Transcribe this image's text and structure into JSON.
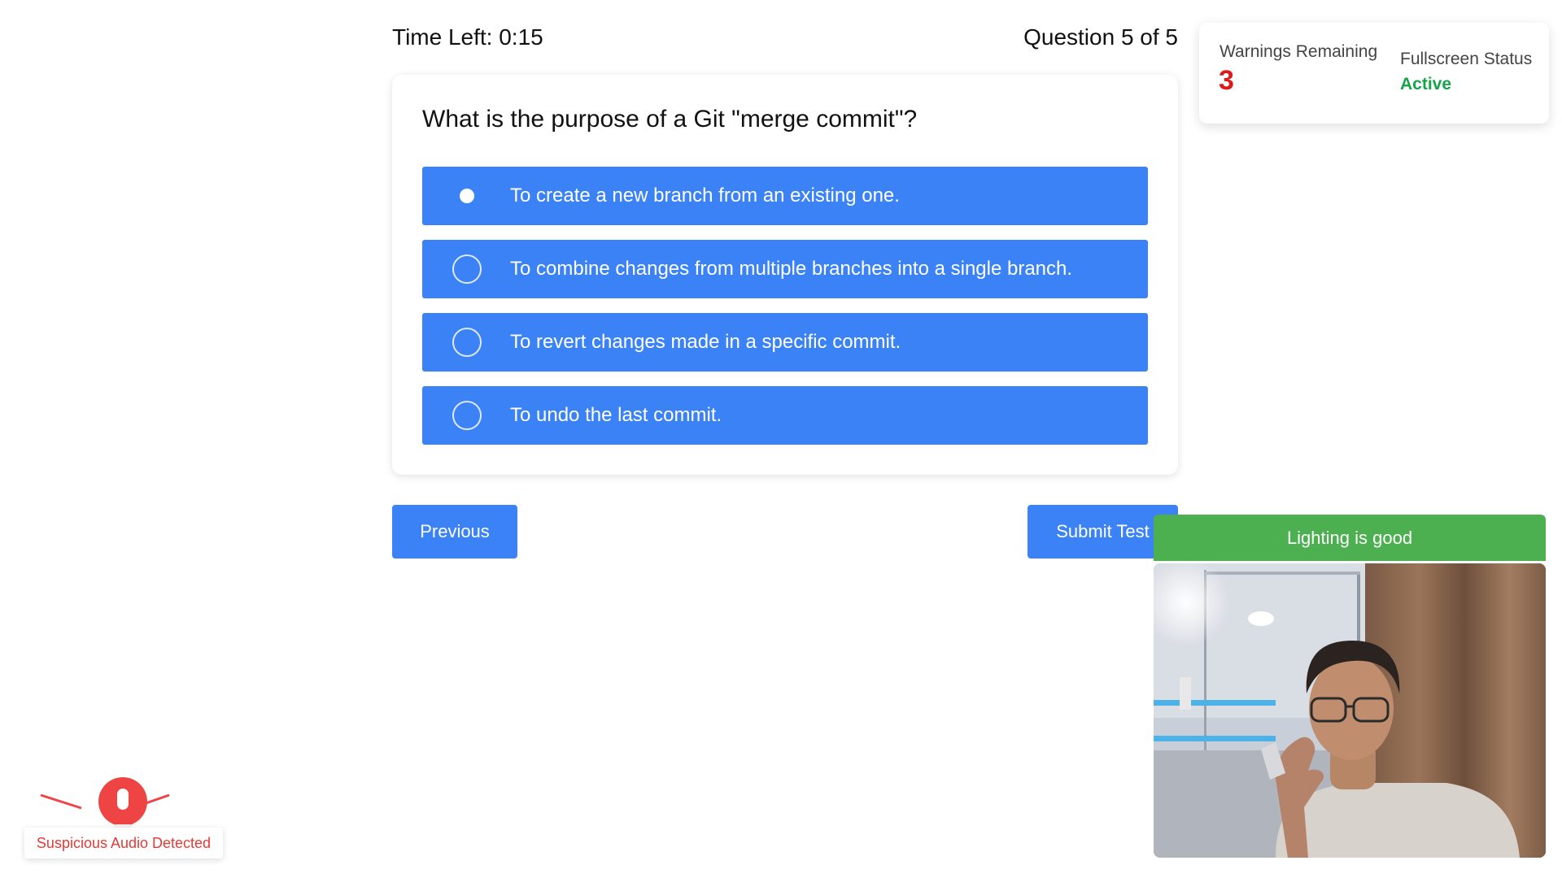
{
  "header": {
    "timer": "Time Left: 0:15",
    "question_counter": "Question 5 of 5"
  },
  "question": {
    "text": "What is the purpose of a Git \"merge commit\"?",
    "selected_index": 0,
    "options": [
      "To create a new branch from an existing one.",
      "To combine changes from multiple branches into a single branch.",
      "To revert changes made in a specific commit.",
      "To undo the last commit."
    ]
  },
  "navigation": {
    "previous_label": "Previous",
    "submit_label": "Submit Test"
  },
  "status_panel": {
    "warnings_label": "Warnings Remaining",
    "warnings_count": "3",
    "fullscreen_label": "Fullscreen Status",
    "fullscreen_value": "Active"
  },
  "camera": {
    "lighting_status": "Lighting is good"
  },
  "audio_alert": {
    "label": "Suspicious Audio Detected"
  },
  "colors": {
    "primary": "#3b82f6",
    "warning_red": "#dc1a1a",
    "active_green": "#16a34a",
    "lighting_green": "#4caf50",
    "alert_red": "#ef4444"
  }
}
